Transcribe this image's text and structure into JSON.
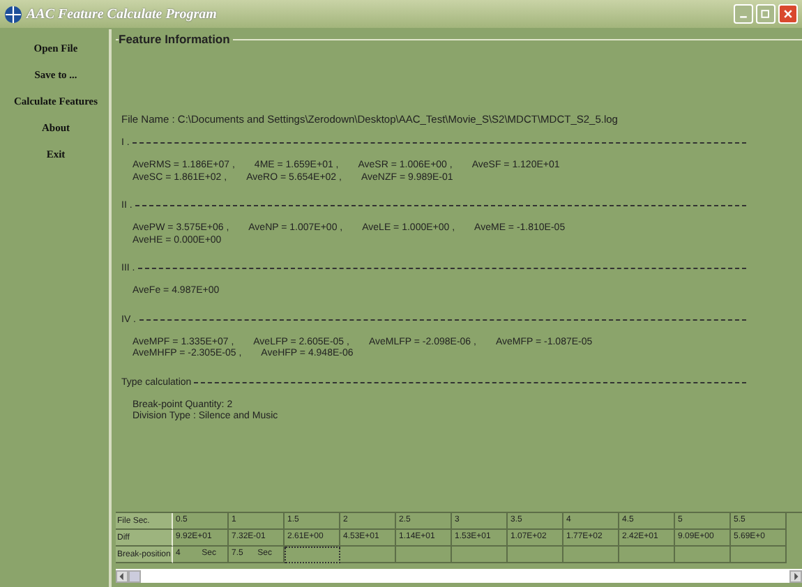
{
  "window": {
    "title": "AAC Feature Calculate Program"
  },
  "sidebar": {
    "items": [
      {
        "label": "Open File"
      },
      {
        "label": "Save to ..."
      },
      {
        "label": "Calculate Features"
      },
      {
        "label": "About"
      },
      {
        "label": "Exit"
      }
    ]
  },
  "panel": {
    "title": "Feature Information",
    "file_name": "File Name :  C:\\Documents and Settings\\Zerodown\\Desktop\\AAC_Test\\Movie_S\\S2\\MDCT\\MDCT_S2_5.log",
    "sections": [
      {
        "header": "I .",
        "lines": [
          [
            "AveRMS = 1.186E+07  ,",
            "4ME   = 1.659E+01  ,",
            "AveSR  = 1.006E+00  ,",
            "AveSF  = 1.120E+01"
          ],
          [
            "AveSC  = 1.861E+02  ,",
            "AveRO  = 5.654E+02  ,",
            "AveNZF  = 9.989E-01"
          ]
        ]
      },
      {
        "header": "II .",
        "lines": [
          [
            "AvePW  = 3.575E+06  ,",
            "AveNP  = 1.007E+00  ,",
            "AveLE  = 1.000E+00  ,",
            "AveME  = -1.810E-05"
          ],
          [
            "AveHE  = 0.000E+00"
          ]
        ]
      },
      {
        "header": "III .",
        "lines": [
          [
            "AveFe  = 4.987E+00"
          ]
        ]
      },
      {
        "header": "IV .",
        "lines": [
          [
            "AveMPF  = 1.335E+07  ,",
            "AveLFP  = 2.605E-05  ,",
            "AveMLFP  = -2.098E-06  ,",
            "AveMFP  = -1.087E-05"
          ],
          [
            "AveMHFP  = -2.305E-05  ,",
            "AveHFP  = 4.948E-06"
          ]
        ]
      },
      {
        "header": "Type calculation",
        "lines": [
          [
            "Break-point Quantity:  2"
          ],
          [
            "Division Type :  Silence  and  Music"
          ]
        ]
      }
    ]
  },
  "grid": {
    "rows": [
      {
        "header": "File Sec.",
        "cells": [
          "0.5",
          "1",
          "1.5",
          "2",
          "2.5",
          "3",
          "3.5",
          "4",
          "4.5",
          "5",
          "5.5"
        ]
      },
      {
        "header": "Diff",
        "cells": [
          "9.92E+01",
          "7.32E-01",
          "2.61E+00",
          "4.53E+01",
          "1.14E+01",
          "1.53E+01",
          "1.07E+02",
          "1.77E+02",
          "2.42E+01",
          "9.09E+00",
          "5.69E+0"
        ]
      },
      {
        "header": "Break-position",
        "cells": [
          {
            "value": "4",
            "unit": "Sec",
            "focused": false
          },
          {
            "value": "7.5",
            "unit": "Sec",
            "focused": false
          },
          {
            "focused": true
          },
          {
            "focused": false
          },
          {
            "focused": false
          },
          {
            "focused": false
          },
          {
            "focused": false
          },
          {
            "focused": false
          },
          {
            "focused": false
          },
          {
            "focused": false
          },
          {
            "focused": false
          }
        ]
      }
    ]
  }
}
